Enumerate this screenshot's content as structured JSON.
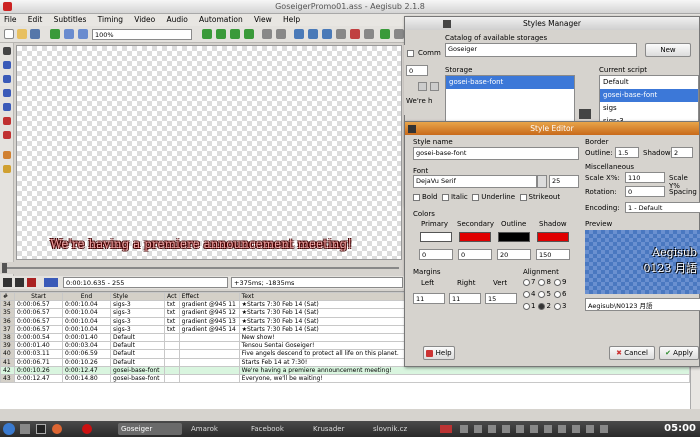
{
  "app": {
    "title": "GoseigerPromo01.ass - Aegisub 2.1.8"
  },
  "menu": [
    "File",
    "Edit",
    "Subtitles",
    "Timing",
    "Video",
    "Audio",
    "Automation",
    "View",
    "Help"
  ],
  "toolbar": {
    "zoom": "100%"
  },
  "video": {
    "subtitle": "We're having a premiere announcement meeting!"
  },
  "controls": {
    "time": "0:00:10.635 - 255",
    "offset": "+375ms; -1835ms"
  },
  "grid": {
    "headers": [
      "#",
      "Start",
      "End",
      "Style",
      "Act",
      "Effect",
      "Text"
    ],
    "rows": [
      [
        "34",
        "0:00:06.57",
        "0:00:10.04",
        "sigs-3",
        "txt",
        "gradient @945 11",
        "★Starts 7:30 Feb 14 (Sat)"
      ],
      [
        "35",
        "0:00:06.57",
        "0:00:10.04",
        "sigs-3",
        "txt",
        "gradient @945 12",
        "★Starts 7:30 Feb 14 (Sat)"
      ],
      [
        "36",
        "0:00:06.57",
        "0:00:10.04",
        "sigs-3",
        "txt",
        "gradient @945 13",
        "★Starts 7:30 Feb 14 (Sat)"
      ],
      [
        "37",
        "0:00:06.57",
        "0:00:10.04",
        "sigs-3",
        "txt",
        "gradient @945 14",
        "★Starts 7:30 Feb 14 (Sat)"
      ],
      [
        "38",
        "0:00:00.54",
        "0:00:01.40",
        "Default",
        "",
        "",
        "New show!"
      ],
      [
        "39",
        "0:00:01.40",
        "0:00:03.04",
        "Default",
        "",
        "",
        "Tensou Sentai Goseiger!"
      ],
      [
        "40",
        "0:00:03.11",
        "0:00:06.59",
        "Default",
        "",
        "",
        "Five angels descend to protect all life on this planet."
      ],
      [
        "41",
        "0:00:06.71",
        "0:00:10.26",
        "Default",
        "",
        "",
        "Starts Feb 14 at 7:30!"
      ],
      [
        "42",
        "0:00:10.26",
        "0:00:12.47",
        "gosei-base-font",
        "",
        "",
        "We're having a premiere announcement meeting!"
      ],
      [
        "43",
        "0:00:12.47",
        "0:00:14.80",
        "gosei-base-font",
        "",
        "",
        "Everyone, we'll be waiting!"
      ]
    ]
  },
  "taskbar": {
    "items": [
      "Goseiger",
      "Amarok",
      "Facebook",
      "Krusader",
      "slovnik.cz"
    ],
    "clock": "05:00"
  },
  "styles_manager": {
    "title": "Styles Manager",
    "catalog_label": "Catalog of available storages",
    "catalog_value": "Goseiger",
    "new_label": "New",
    "storage_label": "Storage",
    "storage_items": [
      "gosei-base-font"
    ],
    "current_label": "Current script",
    "current_items": [
      "Default",
      "gosei-base-font",
      "sigs",
      "sigs-3"
    ],
    "comment_label": "Comm",
    "preview_text": "We're h"
  },
  "style_editor": {
    "title": "Style Editor",
    "style_name_label": "Style name",
    "style_name": "gosei-base-font",
    "font_label": "Font",
    "font_name": "DejaVu Serif",
    "font_size": "25",
    "bold": "Bold",
    "italic": "Italic",
    "underline": "Underline",
    "strikeout": "Strikeout",
    "colors_label": "Colors",
    "color_headers": [
      "Primary",
      "Secondary",
      "Outline",
      "Shadow"
    ],
    "color_values": [
      "#ffffff",
      "#e00000",
      "#000000",
      "#e00000"
    ],
    "alpha_values": [
      "0",
      "0",
      "20",
      "150"
    ],
    "margins_label": "Margins",
    "margin_headers": [
      "Left",
      "Right",
      "Vert"
    ],
    "margin_values": [
      "11",
      "11",
      "15"
    ],
    "alignment_label": "Alignment",
    "alignment_rows": [
      [
        "7",
        "8",
        "9"
      ],
      [
        "4",
        "5",
        "6"
      ],
      [
        "1",
        "2",
        "3"
      ]
    ],
    "border_label": "Border",
    "outline_label": "Outline:",
    "outline_value": "1.5",
    "shadow_label": "Shadow:",
    "shadow_value": "2",
    "misc_label": "Miscellaneous",
    "scalex_label": "Scale X%:",
    "scalex_value": "110",
    "scaley_label": "Scale Y%",
    "rotation_label": "Rotation:",
    "rotation_value": "0",
    "spacing_label": "Spacing",
    "encoding_label": "Encoding:",
    "encoding_value": "1 - Default",
    "preview_label": "Preview",
    "preview_line1": "Aegisub",
    "preview_line2": "0123 月語",
    "preview_input": "Aegisub\\N0123 月語",
    "help_label": "Help",
    "cancel_label": "Cancel",
    "apply_label": "Apply"
  },
  "colors": {
    "accent": "#3c78d8",
    "selected_row": "#c8e8ff",
    "highlight_row": "#d9f5df"
  }
}
